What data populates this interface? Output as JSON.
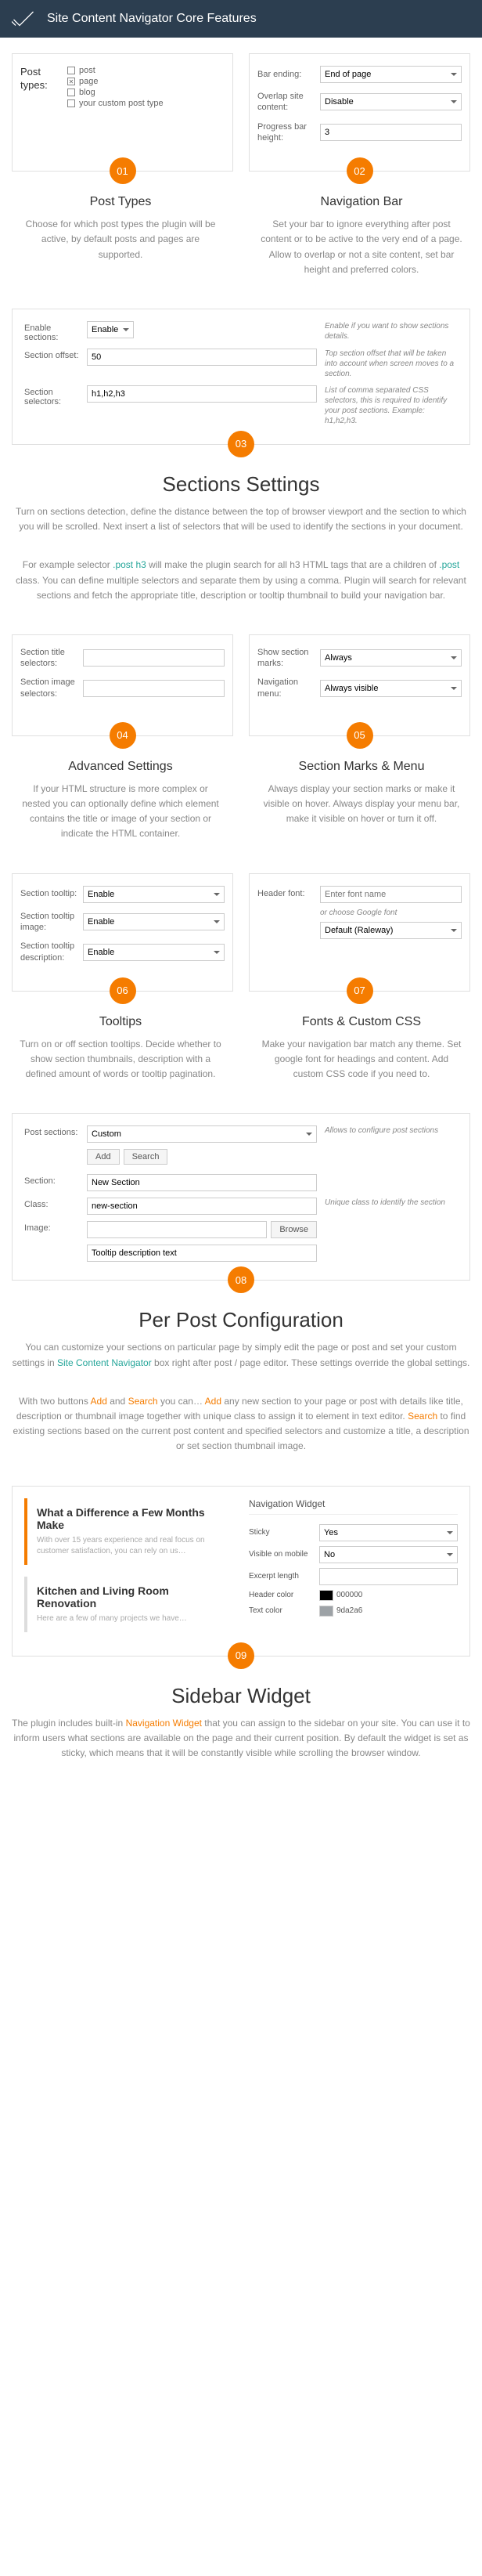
{
  "header": "Site Content Navigator Core Features",
  "s01": {
    "badge": "01",
    "label": "Post types:",
    "opts": [
      "post",
      "page",
      "blog",
      "your custom post type"
    ],
    "checked": [
      false,
      true,
      false,
      false
    ],
    "title": "Post Types",
    "desc": "Choose for which post types the plugin will be active, by default posts and pages are supported."
  },
  "s02": {
    "badge": "02",
    "f1l": "Bar ending:",
    "f1v": "End of page",
    "f2l": "Overlap site content:",
    "f2v": "Disable",
    "f3l": "Progress bar height:",
    "f3v": "3",
    "title": "Navigation Bar",
    "desc": "Set your bar to ignore everything after post content or to be active to the very end of a page. Allow to overlap or not a site content, set bar height and preferred colors."
  },
  "s03": {
    "badge": "03",
    "r1l": "Enable sections:",
    "r1v": "Enable",
    "r1h": "Enable if you want to show sections details.",
    "r2l": "Section offset:",
    "r2v": "50",
    "r2h": "Top section offset that will be taken into account when screen moves to a section.",
    "r3l": "Section selectors:",
    "r3v": "h1,h2,h3",
    "r3h": "List of comma separated CSS selectors, this is required to identify your post sections. Example: h1,h2,h3.",
    "title": "Sections Settings",
    "desc1": "Turn on sections detection, define the distance between the top of browser viewport and the section to which you will be scrolled. Next insert a list of selectors that will be used to identify the sections in your document.",
    "desc2a": "For example selector ",
    "desc2b": ".post h3",
    "desc2c": " will make the plugin search for all h3 HTML tags that are a children of ",
    "desc2d": ".post",
    "desc2e": " class. You can define multiple selectors and separate them by using a comma. Plugin will search for relevant sections and fetch the appropriate title, description or tooltip thumbnail to build your navigation bar."
  },
  "s04": {
    "badge": "04",
    "f1l": "Section title selectors:",
    "f2l": "Section image selectors:",
    "title": "Advanced Settings",
    "desc": "If your HTML structure is more complex or nested you can optionally define which element contains the title or image of your section or indicate the HTML container."
  },
  "s05": {
    "badge": "05",
    "f1l": "Show section marks:",
    "f1v": "Always",
    "f2l": "Navigation menu:",
    "f2v": "Always visible",
    "title": "Section Marks & Menu",
    "desc": "Always display your section marks or make it visible on hover. Always display your menu bar, make it visible on hover or turn it off."
  },
  "s06": {
    "badge": "06",
    "f1l": "Section tooltip:",
    "f1v": "Enable",
    "f2l": "Section tooltip image:",
    "f2v": "Enable",
    "f3l": "Section tooltip description:",
    "f3v": "Enable",
    "title": "Tooltips",
    "desc": "Turn on or off section tooltips. Decide whether to show section thumbnails, description with a defined amount of words or tooltip pagination."
  },
  "s07": {
    "badge": "07",
    "f1l": "Header font:",
    "f1p": "Enter font name",
    "f1s": "or choose Google font",
    "f1v": "Default (Raleway)",
    "title": "Fonts & Custom CSS",
    "desc": "Make your navigation bar match any theme. Set google font for headings and content. Add custom CSS code if you need to."
  },
  "s08": {
    "badge": "08",
    "r1l": "Post sections:",
    "r1v": "Custom",
    "r1h": "Allows to configure post sections",
    "b1": "Add",
    "b2": "Search",
    "r2l": "Section:",
    "r2v": "New Section",
    "r3l": "Class:",
    "r3v": "new-section",
    "r3h": "Unique class to identify the section",
    "r4l": "Image:",
    "r4b": "Browse",
    "r5v": "Tooltip description text",
    "title": "Per Post Configuration",
    "desc1a": "You can customize your sections on particular page by simply edit the page or post and set your custom settings in ",
    "desc1b": "Site Content Navigator",
    "desc1c": " box right after post / page editor. These settings override the global settings.",
    "desc2a": "With two buttons ",
    "desc2b": "Add",
    "desc2c": " and ",
    "desc2d": "Search",
    "desc2e": " you can… ",
    "desc2f": "Add",
    "desc2g": " any new section to your page or post with details like title, description or thumbnail image together with unique class to assign it to element in text editor. ",
    "desc2h": "Search",
    "desc2i": " to find existing sections based on the current post content and specified selectors and customize a title, a description or set section thumbnail image."
  },
  "s09": {
    "badge": "09",
    "w1t": "What a Difference a Few Months Make",
    "w1s": "With over 15 years experience and real focus on customer satisfaction, you can rely on us…",
    "w2t": "Kitchen and Living Room Renovation",
    "w2s": "Here are a few of many projects we have…",
    "ntitle": "Navigation Widget",
    "f1l": "Sticky",
    "f1v": "Yes",
    "f2l": "Visible on mobile",
    "f2v": "No",
    "f3l": "Excerpt length",
    "f4l": "Header color",
    "f4v": "000000",
    "f5l": "Text color",
    "f5v": "9da2a6",
    "title": "Sidebar Widget",
    "desc1a": "The plugin includes built-in ",
    "desc1b": "Navigation Widget",
    "desc1c": " that you can assign to the sidebar on your site. You can use it to inform users what sections are available on the page and their current position. By default the widget is set as sticky, which means that it will be constantly visible while scrolling the browser window."
  }
}
